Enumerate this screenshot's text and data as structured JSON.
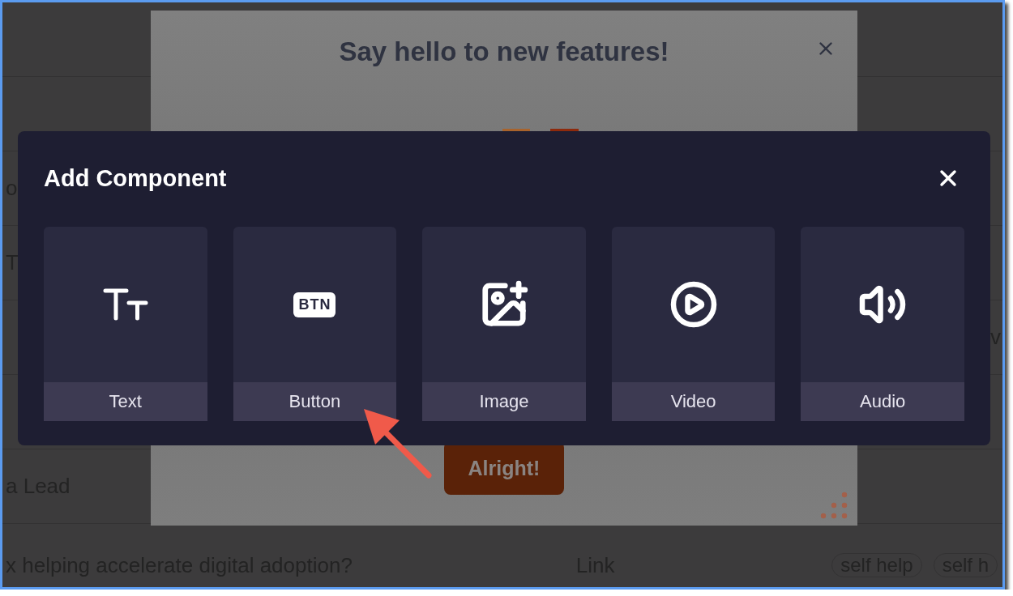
{
  "background": {
    "rows": [
      {
        "kind": "blank"
      },
      {
        "kind": "blank"
      },
      {
        "kind": "text",
        "left": "o"
      },
      {
        "kind": "text",
        "left": "T"
      },
      {
        "kind": "text",
        "right": "v"
      },
      {
        "kind": "blank"
      },
      {
        "kind": "text",
        "left": "a Lead"
      },
      {
        "kind": "detail",
        "left": "x helping accelerate digital adoption?",
        "link": "Link",
        "tags": [
          "self help",
          "self h"
        ]
      }
    ]
  },
  "feature_modal": {
    "title": "Say hello to new features!",
    "button": "Alright!"
  },
  "dialog": {
    "title": "Add Component",
    "components": [
      {
        "kind": "text",
        "label": "Text"
      },
      {
        "kind": "button",
        "label": "Button",
        "icon_text": "BTN"
      },
      {
        "kind": "image",
        "label": "Image"
      },
      {
        "kind": "video",
        "label": "Video"
      },
      {
        "kind": "audio",
        "label": "Audio"
      }
    ]
  }
}
